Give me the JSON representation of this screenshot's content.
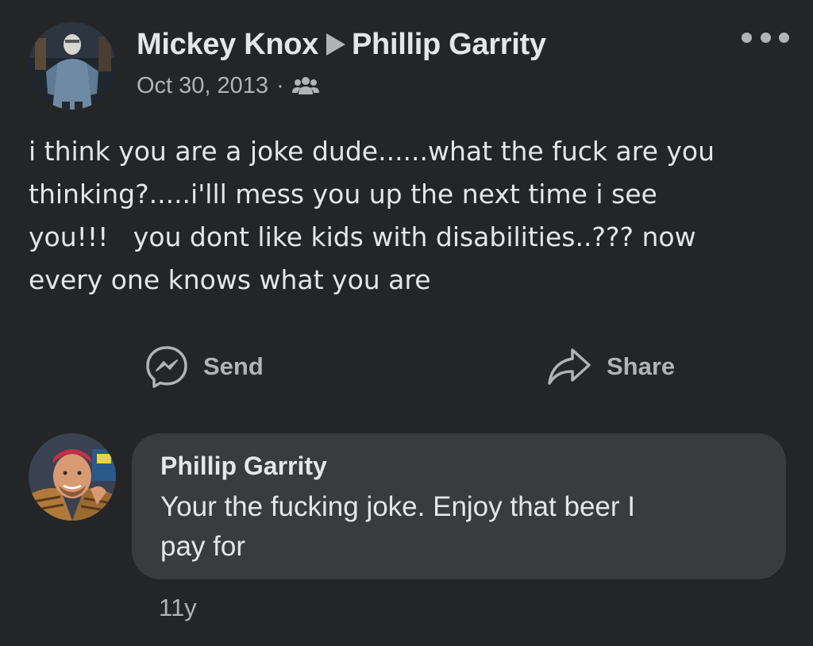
{
  "post": {
    "author": "Mickey Knox",
    "recipient": "Phillip Garrity",
    "date": "Oct 30, 2013",
    "separator": "·",
    "audience_icon": "friends-icon",
    "more_icon": "more-options-icon",
    "text": "i think you are a joke dude......what the fuck are you\nthinking?.....i'lll mess you up the next time i see\nyou!!!   you dont like kids with disabilities..??? now\nevery one knows what you are"
  },
  "actions": {
    "send_label": "Send",
    "send_icon": "messenger-icon",
    "share_label": "Share",
    "share_icon": "share-arrow-icon"
  },
  "comment": {
    "author": "Phillip Garrity",
    "text": "Your the fucking joke. Enjoy that beer I\npay for",
    "age": "11y"
  },
  "colors": {
    "background": "#242526",
    "bubble": "#3a3b3c",
    "primary_text": "#e4e6eb",
    "secondary_text": "#b0b3b8"
  }
}
